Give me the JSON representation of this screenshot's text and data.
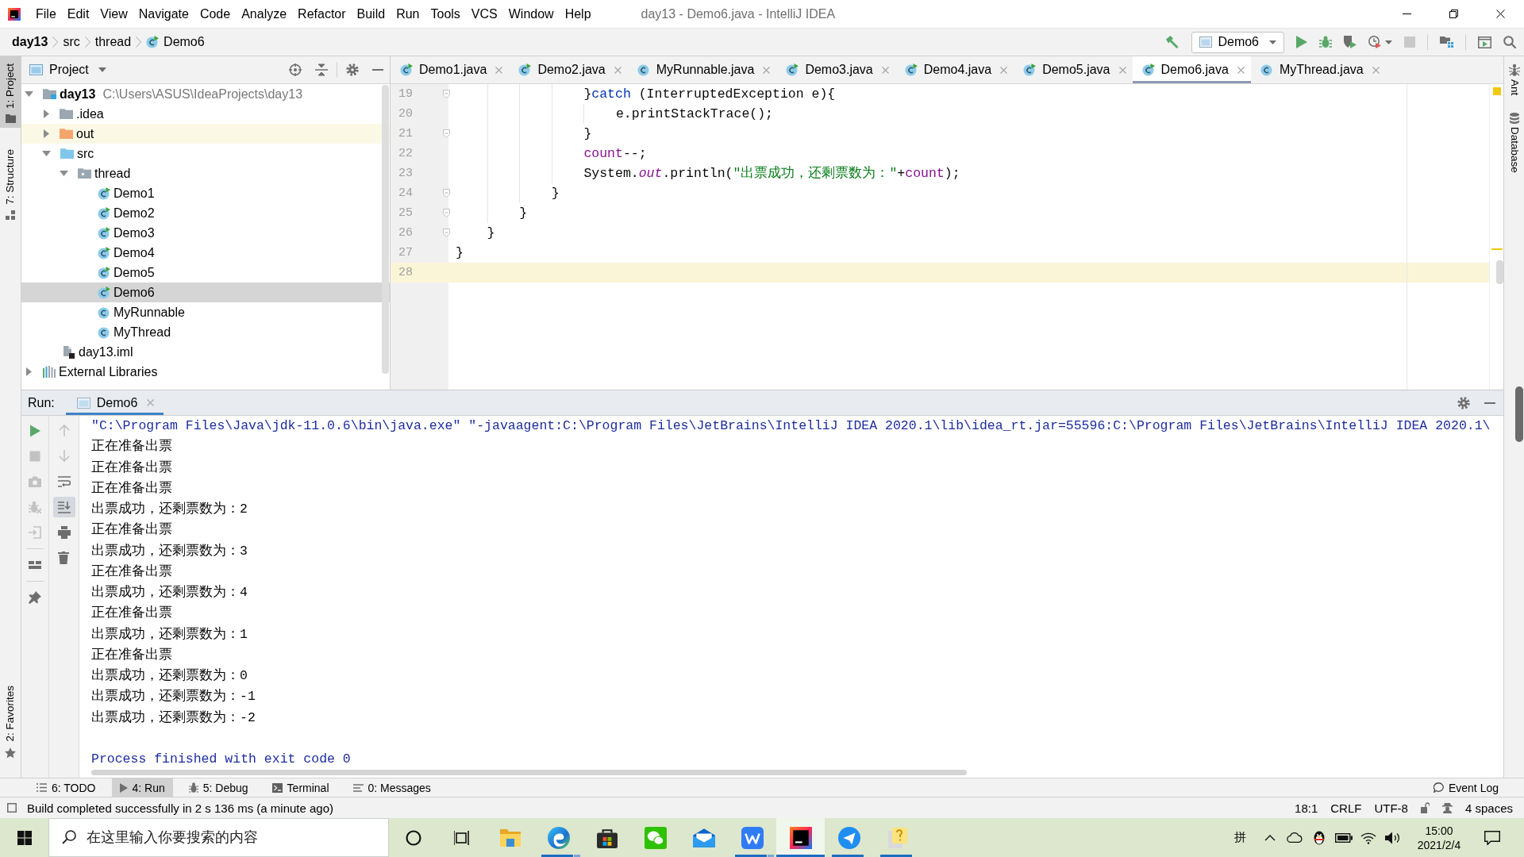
{
  "window": {
    "title": "day13 - Demo6.java - IntelliJ IDEA"
  },
  "menu": [
    "File",
    "Edit",
    "View",
    "Navigate",
    "Code",
    "Analyze",
    "Refactor",
    "Build",
    "Run",
    "Tools",
    "VCS",
    "Window",
    "Help"
  ],
  "breadcrumbs": [
    {
      "label": "day13",
      "kind": "project"
    },
    {
      "label": "src",
      "kind": "folder"
    },
    {
      "label": "thread",
      "kind": "folder"
    },
    {
      "label": "Demo6",
      "kind": "runnable"
    }
  ],
  "run_config": {
    "label": "Demo6"
  },
  "left_tool_tabs": [
    {
      "label": "1: Project",
      "kind": "project",
      "selected": true
    },
    {
      "label": "7: Structure",
      "kind": "structure",
      "selected": false
    },
    {
      "label": "2: Favorites",
      "kind": "favorites",
      "selected": false
    }
  ],
  "right_tool_tabs": [
    {
      "label": "Ant",
      "kind": "ant",
      "selected": false
    },
    {
      "label": "Database",
      "kind": "database",
      "selected": false
    }
  ],
  "project_panel": {
    "title": "Project"
  },
  "project_tree": [
    {
      "label": "day13",
      "path": "C:\\Users\\ASUS\\IdeaProjects\\day13",
      "kind": "module",
      "expanded": true,
      "selected": false,
      "children": [
        {
          "label": ".idea",
          "kind": "folder",
          "expanded": false,
          "selected": false
        },
        {
          "label": "out",
          "kind": "excluded",
          "expanded": false,
          "selected": false
        },
        {
          "label": "src",
          "kind": "source",
          "expanded": true,
          "selected": false,
          "children": [
            {
              "label": "thread",
              "kind": "package",
              "expanded": true,
              "selected": false,
              "children": [
                {
                  "label": "Demo1",
                  "kind": "runnable",
                  "selected": false
                },
                {
                  "label": "Demo2",
                  "kind": "runnable",
                  "selected": false
                },
                {
                  "label": "Demo3",
                  "kind": "runnable",
                  "selected": false
                },
                {
                  "label": "Demo4",
                  "kind": "runnable",
                  "selected": false
                },
                {
                  "label": "Demo5",
                  "kind": "runnable",
                  "selected": false
                },
                {
                  "label": "Demo6",
                  "kind": "runnable",
                  "selected": true
                },
                {
                  "label": "MyRunnable",
                  "kind": "class",
                  "selected": false
                },
                {
                  "label": "MyThread",
                  "kind": "class",
                  "selected": false
                }
              ]
            }
          ]
        },
        {
          "label": "day13.iml",
          "kind": "module_file",
          "selected": false
        }
      ]
    },
    {
      "label": "External Libraries",
      "kind": "library",
      "expanded": false,
      "selected": false
    }
  ],
  "editor_tabs": [
    {
      "label": "Demo1.java",
      "kind": "runnable",
      "selected": false
    },
    {
      "label": "Demo2.java",
      "kind": "runnable",
      "selected": false
    },
    {
      "label": "MyRunnable.java",
      "kind": "class",
      "selected": false
    },
    {
      "label": "Demo3.java",
      "kind": "runnable",
      "selected": false
    },
    {
      "label": "Demo4.java",
      "kind": "runnable",
      "selected": false
    },
    {
      "label": "Demo5.java",
      "kind": "runnable",
      "selected": false
    },
    {
      "label": "Demo6.java",
      "kind": "runnable",
      "selected": true
    },
    {
      "label": "MyThread.java",
      "kind": "class",
      "selected": false
    }
  ],
  "editor": {
    "lines": [
      {
        "number": "19",
        "foldable": true,
        "current": false,
        "tokens": [
          {
            "text": "                }",
            "kind": "plain"
          },
          {
            "text": "catch",
            "kind": "keyword"
          },
          {
            "text": " (InterruptedException e){",
            "kind": "plain"
          }
        ]
      },
      {
        "number": "20",
        "foldable": false,
        "current": false,
        "tokens": [
          {
            "text": "                    e.printStackTrace();",
            "kind": "plain"
          }
        ]
      },
      {
        "number": "21",
        "foldable": true,
        "current": false,
        "tokens": [
          {
            "text": "                }",
            "kind": "plain"
          }
        ]
      },
      {
        "number": "22",
        "foldable": false,
        "current": false,
        "tokens": [
          {
            "text": "                count",
            "kind": "field"
          },
          {
            "text": "--;",
            "kind": "plain"
          }
        ]
      },
      {
        "number": "23",
        "foldable": false,
        "current": false,
        "tokens": [
          {
            "text": "                System.",
            "kind": "plain"
          },
          {
            "text": "out",
            "kind": "static"
          },
          {
            "text": ".println(",
            "kind": "plain"
          },
          {
            "text": "\"出票成功，还剩票数为：\"",
            "kind": "string"
          },
          {
            "text": "+",
            "kind": "plain"
          },
          {
            "text": "count",
            "kind": "field"
          },
          {
            "text": ");",
            "kind": "plain"
          }
        ]
      },
      {
        "number": "24",
        "foldable": true,
        "current": false,
        "tokens": [
          {
            "text": "            }",
            "kind": "plain"
          }
        ]
      },
      {
        "number": "25",
        "foldable": true,
        "current": false,
        "tokens": [
          {
            "text": "        }",
            "kind": "plain"
          }
        ]
      },
      {
        "number": "26",
        "foldable": true,
        "current": false,
        "tokens": [
          {
            "text": "    }",
            "kind": "plain"
          }
        ]
      },
      {
        "number": "27",
        "foldable": false,
        "current": false,
        "tokens": [
          {
            "text": "}",
            "kind": "plain"
          }
        ]
      },
      {
        "number": "28",
        "foldable": false,
        "current": true
      }
    ]
  },
  "run_panel": {
    "label": "Run:",
    "tabs": [
      {
        "label": "Demo6",
        "selected": true
      }
    ],
    "left_toolbar": [
      {
        "kind": "rerun",
        "disabled": false
      },
      {
        "kind": "stop",
        "disabled": true
      },
      {
        "kind": "dump",
        "disabled": true
      },
      {
        "kind": "debug",
        "disabled": true
      },
      {
        "kind": "restore",
        "disabled": true
      },
      {
        "kind": "layout",
        "disabled": false
      },
      {
        "kind": "pin",
        "disabled": false
      }
    ],
    "output_toolbar": [
      {
        "kind": "up",
        "on": false,
        "disabled": true
      },
      {
        "kind": "down",
        "on": false,
        "disabled": true
      },
      {
        "kind": "wrap",
        "on": false,
        "disabled": false
      },
      {
        "kind": "scroll_end",
        "on": true,
        "disabled": false
      },
      {
        "kind": "print",
        "on": false,
        "disabled": false
      },
      {
        "kind": "clear",
        "on": false,
        "disabled": false
      }
    ],
    "console": [
      {
        "text": "\"C:\\Program Files\\Java\\jdk-11.0.6\\bin\\java.exe\" \"-javaagent:C:\\Program Files\\JetBrains\\IntelliJ IDEA 2020.1\\lib\\idea_rt.jar=55596:C:\\Program Files\\JetBrains\\IntelliJ IDEA 2020.1\\",
        "kind": "command"
      },
      {
        "text": "正在准备出票",
        "kind": "output"
      },
      {
        "text": "正在准备出票",
        "kind": "output"
      },
      {
        "text": "正在准备出票",
        "kind": "output"
      },
      {
        "text": "出票成功，还剩票数为：2",
        "kind": "output"
      },
      {
        "text": "正在准备出票",
        "kind": "output"
      },
      {
        "text": "出票成功，还剩票数为：3",
        "kind": "output"
      },
      {
        "text": "正在准备出票",
        "kind": "output"
      },
      {
        "text": "出票成功，还剩票数为：4",
        "kind": "output"
      },
      {
        "text": "正在准备出票",
        "kind": "output"
      },
      {
        "text": "出票成功，还剩票数为：1",
        "kind": "output"
      },
      {
        "text": "正在准备出票",
        "kind": "output"
      },
      {
        "text": "出票成功，还剩票数为：0",
        "kind": "output"
      },
      {
        "text": "出票成功，还剩票数为：-1",
        "kind": "output"
      },
      {
        "text": "出票成功，还剩票数为：-2",
        "kind": "output"
      },
      {
        "text": "Process finished with exit code 0",
        "kind": "exit"
      }
    ]
  },
  "bottom_tool_tabs": [
    {
      "label": "6: TODO",
      "kind": "todo",
      "selected": false
    },
    {
      "label": "4: Run",
      "kind": "run",
      "selected": true
    },
    {
      "label": "5: Debug",
      "kind": "debug",
      "selected": false
    },
    {
      "label": "Terminal",
      "kind": "terminal",
      "selected": false
    },
    {
      "label": "0: Messages",
      "kind": "messages",
      "selected": false
    }
  ],
  "event_log": {
    "label": "Event Log"
  },
  "status_bar": {
    "message": "Build completed successfully in 2 s 136 ms (a minute ago)",
    "position": "18:1",
    "line_separator": "CRLF",
    "encoding": "UTF-8",
    "indent": "4 spaces"
  },
  "taskbar": {
    "search_placeholder": "在这里输入你要搜索的内容",
    "apps": [
      {
        "kind": "explorer",
        "running": false,
        "stacked": false,
        "selected": false
      },
      {
        "kind": "browser",
        "running": true,
        "stacked": true,
        "selected": false
      },
      {
        "kind": "store",
        "running": false,
        "stacked": false,
        "selected": false
      },
      {
        "kind": "chat",
        "running": false,
        "stacked": false,
        "selected": false
      },
      {
        "kind": "mail",
        "running": false,
        "stacked": false,
        "selected": false
      },
      {
        "kind": "office",
        "running": true,
        "stacked": true,
        "selected": false
      },
      {
        "kind": "ide",
        "running": true,
        "stacked": false,
        "selected": true
      },
      {
        "kind": "messenger",
        "running": true,
        "stacked": false,
        "selected": false
      },
      {
        "kind": "notes",
        "running": true,
        "stacked": false,
        "selected": false
      }
    ],
    "ime": "拼",
    "time": "15:00",
    "date": "2021/2/4"
  }
}
